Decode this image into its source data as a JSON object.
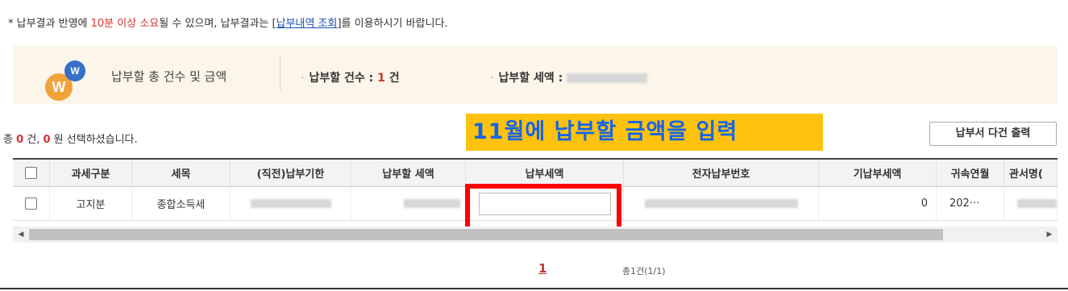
{
  "notice": {
    "prefix": "* 납부결과 반영에 ",
    "highlight": "10분 이상 소요",
    "middle": "될 수 있으며, 납부결과는 [",
    "link": "납부내역 조회",
    "suffix": "]를 이용하시기 바랍니다."
  },
  "summary": {
    "logo_big": "W",
    "logo_small": "W",
    "title": "납부할 총 건수 및 금액",
    "count_label": "납부할 건수 : ",
    "count_value": "1",
    "count_unit": " 건",
    "amount_label": "납부할 세액 : "
  },
  "selection": {
    "prefix": "총 ",
    "count": "0",
    "middle": " 건, ",
    "amount": "0",
    "suffix": " 원 선택하셨습니다."
  },
  "callout": "11월에 납부할 금액을 입력",
  "print_button": "납부서 다건 출력",
  "table": {
    "headers": [
      "과세구분",
      "세목",
      "(직전)납부기한",
      "납부할 세액",
      "납부세액",
      "전자납부번호",
      "기납부세액",
      "귀속연월",
      "관서명("
    ],
    "row": {
      "category": "고지분",
      "tax_item": "종합소득세",
      "paid_amount": "0",
      "period": "202···"
    }
  },
  "pagination": {
    "current_page": "1",
    "total": "총1건(1/1)"
  },
  "colors": {
    "accent_red": "#d9302c",
    "callout_bg": "#ffc20e",
    "callout_text": "#1565e6",
    "highlight_box": "#ff0000",
    "summary_bg": "#fbf5ea"
  }
}
